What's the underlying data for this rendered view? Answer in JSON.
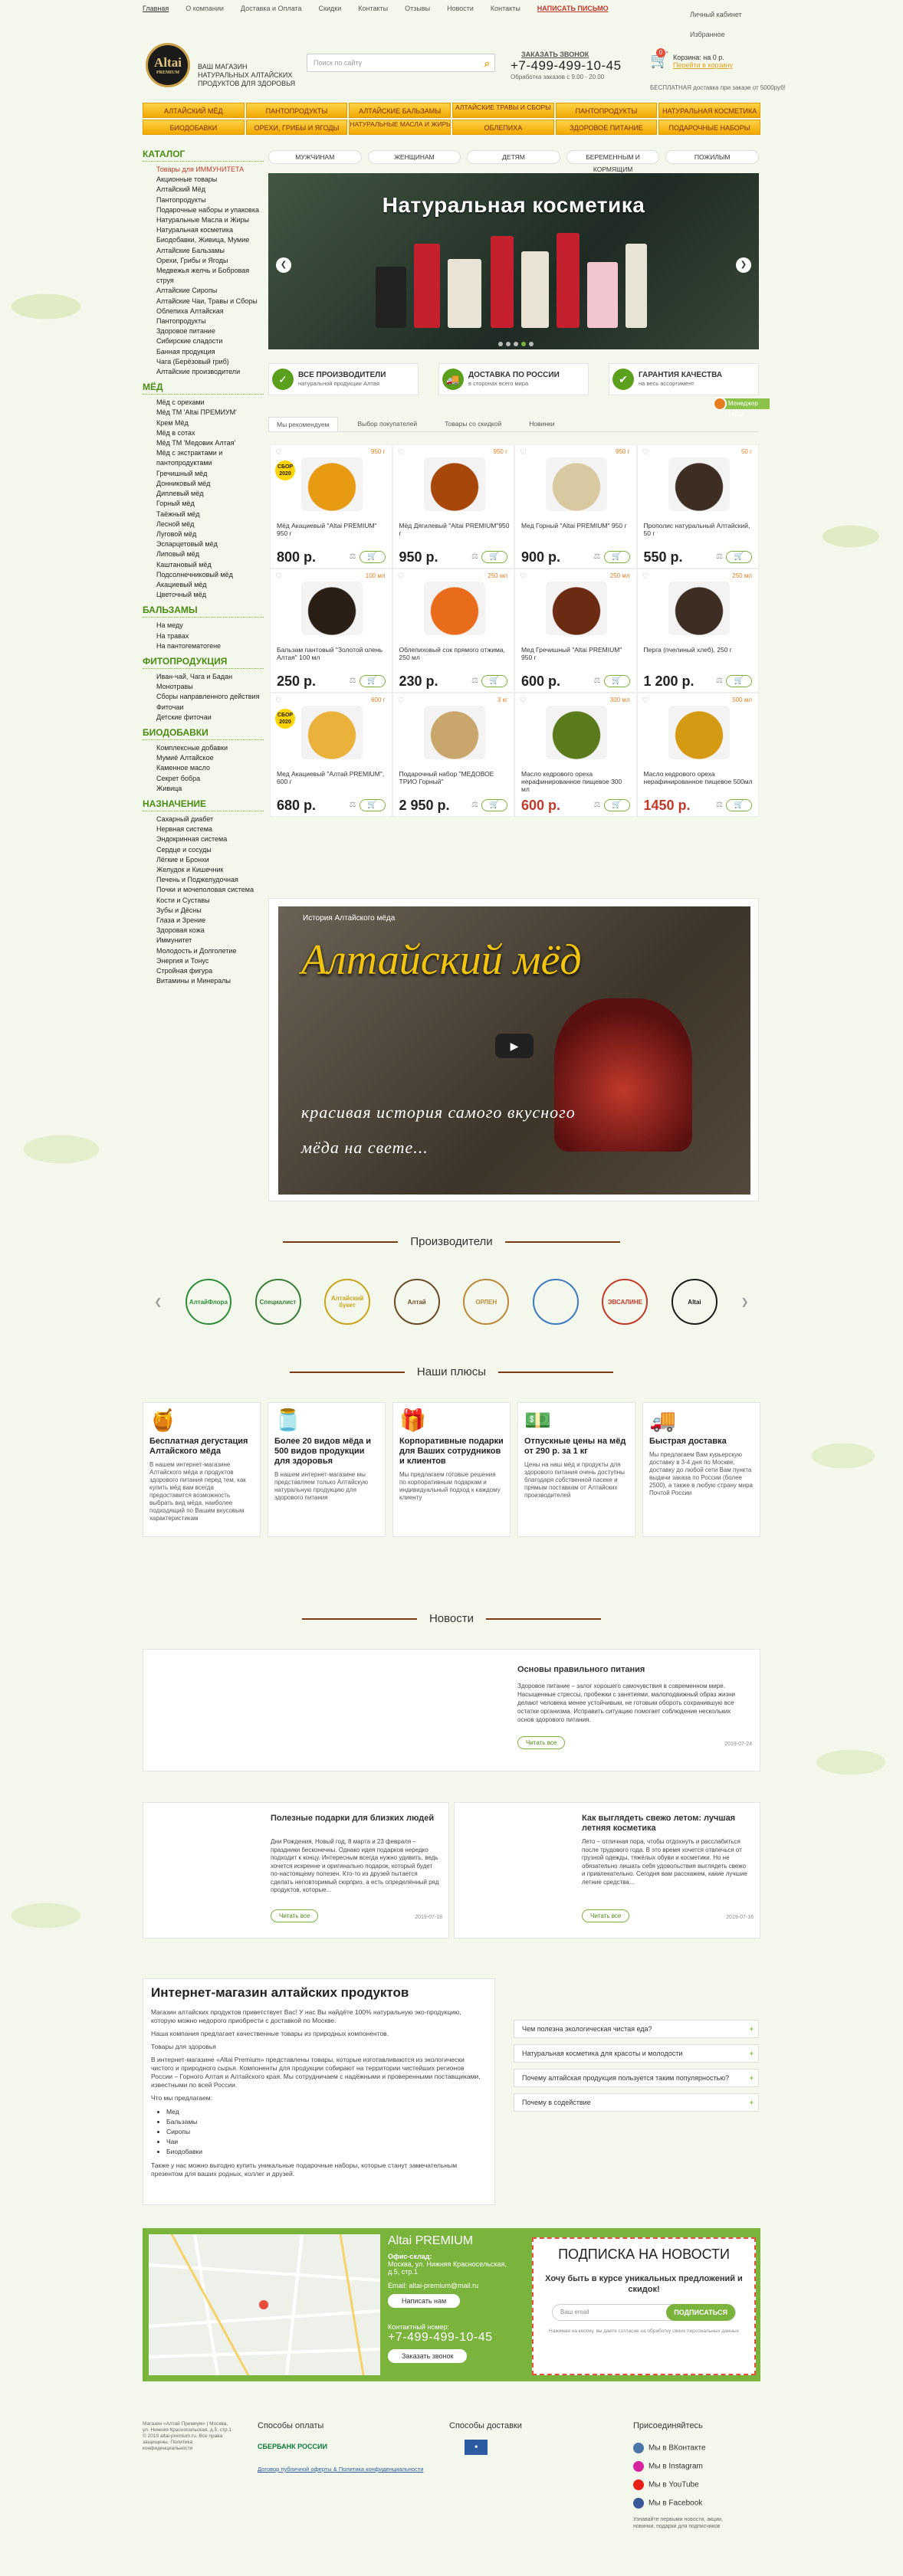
{
  "topbar": {
    "items": [
      "Главная",
      "О компании",
      "Доставка и Оплата",
      "Скидки",
      "Контакты",
      "Отзывы",
      "Новости",
      "Контакты"
    ],
    "write": "НАПИСАТЬ ПИСЬМО",
    "account": "Личный кабинет",
    "favorites": "Избранное"
  },
  "header": {
    "logo": "Altai",
    "logo_sub": "PREMIUM",
    "slogan": "ВАШ МАГАЗИН НАТУРАЛЬНЫХ АЛТАЙСКИХ ПРОДУКТОВ ДЛЯ ЗДОРОВЬЯ",
    "search_placeholder": "Поиск по сайту",
    "call_label": "ЗАКАЗАТЬ ЗВОНОК",
    "phone": "+7-499-499-10-45",
    "hours": "Обработка заказов с 9.00 - 20.00",
    "cart_count": "0",
    "cart_text": "Корзина: на 0 р.",
    "cart_link": "Перейти в корзину",
    "free_ship": "БЕСПЛАТНАЯ доставка при заказе от 5000руб!"
  },
  "nav": [
    "АЛТАЙСКИЙ МЁД",
    "ПАНТОПРОДУКТЫ",
    "АЛТАЙСКИЕ БАЛЬЗАМЫ",
    "АЛТАЙСКИЕ ТРАВЫ И СБОРЫ",
    "ПАНТОПРОДУКТЫ",
    "НАТУРАЛЬНАЯ КОСМЕТИКА",
    "БИОДОБАВКИ",
    "ОРЕХИ, ГРИБЫ И ЯГОДЫ",
    "НАТУРАЛЬНЫЕ МАСЛА И ЖИРЫ",
    "ОБЛЕПИХА",
    "ЗДОРОВОЕ ПИТАНИЕ",
    "ПОДАРОЧНЫЕ НАБОРЫ"
  ],
  "sidebar": [
    {
      "head": "КАТАЛОГ",
      "items": [
        "Товары для ИММУНИТЕТА",
        "Акционные товары",
        "Алтайский Мёд",
        "Пантопродукты",
        "Подарочные наборы и упаковка",
        "Натуральные Масла и Жиры",
        "Натуральная косметика",
        "Биодобавки, Живица, Мумие",
        "Алтайские Бальзамы",
        "Орехи, Грибы и Ягоды",
        "Медвежья желчь и Бобровая струя",
        "Алтайские Сиропы",
        "Алтайские Чаи, Травы и Сборы",
        "Облепиха Алтайская",
        "Пантопродукты",
        "Здоровое питание",
        "Сибирские сладости",
        "Банная продукция",
        "Чага (Берёзовый гриб)",
        "Алтайские производители"
      ]
    },
    {
      "head": "МЁД",
      "items": [
        "Мёд с орехами",
        "Мёд ТМ 'Altai ПРЕМИУМ'",
        "Крем Мёд",
        "Мёд в сотах",
        "Мёд ТМ 'Медовик Алтая'",
        "Мёд с экстрактами и пантопродуктами",
        "Гречишный мёд",
        "Донниковый мёд",
        "Диплевый мёд",
        "Горный мёд",
        "Таёжный мёд",
        "Лесной мёд",
        "Луговой мёд",
        "Эспарцетовый мёд",
        "Липовый мёд",
        "Каштановый мёд",
        "Подсолнечниковый мёд",
        "Акациевый мёд",
        "Цветочный мёд"
      ]
    },
    {
      "head": "БАЛЬЗАМЫ",
      "items": [
        "На меду",
        "На травах",
        "На пантогематогене"
      ]
    },
    {
      "head": "ФИТОПРОДУКЦИЯ",
      "items": [
        "Иван-чай, Чага и Бадан",
        "Монотравы",
        "Сборы направленного действия",
        "Фиточаи",
        "Детские фиточаи"
      ]
    },
    {
      "head": "БИОДОБАВКИ",
      "items": [
        "Комплексные добавки",
        "Мумиё Алтайское",
        "Каменное масло",
        "Секрет бобра",
        "Живица"
      ]
    },
    {
      "head": "НАЗНАЧЕНИЕ",
      "items": [
        "Сахарный диабет",
        "Нервная система",
        "Эндокринная система",
        "Сердце и сосуды",
        "Лёгкие и Бронхи",
        "Желудок и Кишечник",
        "Печень и Поджелудочная",
        "Почки и мочеполовая система",
        "Кости и Суставы",
        "Зубы и Дёсны",
        "Глаза и Зрение",
        "Здоровая кожа",
        "Иммунитет",
        "Молодость и Долголетие",
        "Энергия и Тонус",
        "Стройная фигура",
        "Витамины и Минералы"
      ]
    }
  ],
  "filters": [
    "МУЖЧИНАМ",
    "ЖЕНЩИНАМ",
    "ДЕТЯМ",
    "БЕРЕМЕННЫМ И КОРМЯЩИМ",
    "ПОЖИЛЫМ"
  ],
  "banner": {
    "title": "Натуральная косметика"
  },
  "features": [
    {
      "title": "ВСЕ ПРОИЗВОДИТЕЛИ",
      "sub": "натуральной продукции Алтая",
      "icon": "✓"
    },
    {
      "title": "ДОСТАВКА ПО РОССИИ",
      "sub": "в сторонах всего мира",
      "icon": "🚚"
    },
    {
      "title": "ГАРАНТИЯ КАЧЕСТВА",
      "sub": "на весь ассортимент",
      "icon": "✔"
    }
  ],
  "manager": "Менеджер сайта",
  "tabs": [
    "Мы рекомендуем",
    "Выбор покупателей",
    "Товары со скидкой",
    "Новинки"
  ],
  "products": [
    {
      "weight": "950 г",
      "name": "Мёд Акациевый \"Altai PREMIUM\" 950 г",
      "price": "800 р.",
      "color": "#e79a13",
      "badge": "СБОР 2020"
    },
    {
      "weight": "950 г",
      "name": "Мёд Дягилевый \"Altai PREMIUM\"950 г",
      "price": "950 р.",
      "color": "#a8470a",
      "badge": ""
    },
    {
      "weight": "950 г",
      "name": "Мед Горный \"Altai PREMIUM\" 950 г",
      "price": "900 р.",
      "color": "#d9c9a0",
      "badge": ""
    },
    {
      "weight": "50 г",
      "name": "Прополис натуральный Алтайский, 50 г",
      "price": "550 р.",
      "color": "#3d2d22",
      "badge": ""
    },
    {
      "weight": "100 мл",
      "name": "Бальзам пантовый \"Золотой олень Алтая\" 100 мл",
      "price": "250 р.",
      "color": "#2a1f16",
      "badge": ""
    },
    {
      "weight": "250 мл",
      "name": "Облепиховый сок прямого отжима, 250 мл",
      "price": "230 р.",
      "color": "#e96b1c",
      "badge": ""
    },
    {
      "weight": "250 мл",
      "name": "Мед Гречишный \"Altai PREMIUM\" 950 г",
      "price": "600 р.",
      "color": "#6b2a12",
      "badge": ""
    },
    {
      "weight": "250 мл",
      "name": "Перга (пчелиный хлеб), 250 г",
      "price": "1 200 р.",
      "color": "#3d2d22",
      "badge": ""
    },
    {
      "weight": "600 г",
      "name": "Мед Акациевый \"Алтай PREMIUM\", 600 г",
      "price": "680 р.",
      "color": "#eab23a",
      "badge": "СБОР 2020"
    },
    {
      "weight": "3 кг",
      "name": "Подарочный набор \"МЕДОВОЕ ТРИО Горный\"",
      "price": "2 950 р.",
      "color": "#c9a66b",
      "badge": ""
    },
    {
      "weight": "300 мл",
      "name": "Масло кедрового ореха нерафинированное пищевое 300 мл",
      "price": "600 р.",
      "color": "#5a7a1c",
      "badge": "",
      "red": true
    },
    {
      "weight": "500 мл",
      "name": "Масло кедрового ореха нерафинированное пищевое 500мл",
      "price": "1450 р.",
      "color": "#d49a14",
      "badge": "",
      "red": true
    }
  ],
  "video": {
    "title": "История Алтайского мёда",
    "big": "Алтайский мёд",
    "sub": "красивая история самого вкусного мёда на свете..."
  },
  "producers_title": "Производители",
  "producers": [
    {
      "name": "АлтайФлора",
      "color": "#2e8b3a"
    },
    {
      "name": "Специалист",
      "color": "#3a7a3a"
    },
    {
      "name": "Алтайский букет",
      "color": "#c7a51d"
    },
    {
      "name": "Алтай",
      "color": "#6b4a2a"
    },
    {
      "name": "ОРЛЕН",
      "color": "#b88a3a"
    },
    {
      "name": "",
      "color": "#3c7abf"
    },
    {
      "name": "ЭВСАЛИНЕ",
      "color": "#c0392b"
    },
    {
      "name": "Altai",
      "color": "#1b1b1b"
    }
  ],
  "advantages_title": "Наши плюсы",
  "advantages": [
    {
      "title": "Бесплатная дегустация Алтайского мёда",
      "text": "В нашем интернет-магазине Алтайского мёда и продуктов здорового питания перед тем, как купить мёд вам всегда предоставится возможность выбрать вид мёда, наиболее подходящий по Вашим вкусовым характеристикам",
      "icon": "🍯"
    },
    {
      "title": "Более 20 видов мёда и 500 видов продукции для здоровья",
      "text": "В нашем интернет-магазине мы представляем только Алтайскую натуральную продукцию для здорового питания",
      "icon": "🫙"
    },
    {
      "title": "Корпоративные подарки для Ваших сотрудников и клиентов",
      "text": "Мы предлагаем готовые решения по корпоративным подаркам и индивидуальный подход к каждому клиенту",
      "icon": "🎁"
    },
    {
      "title": "Отпускные цены на мёд от 290 р. за 1 кг",
      "text": "Цены на наш мёд и продукты для здорового питания очень доступны благодаря собственной пасеке и прямым поставкам от Алтайских производителей",
      "icon": "💵"
    },
    {
      "title": "Быстрая доставка",
      "text": "Мы предлагаем Вам курьерскую доставку в 3-4 дня по Москве, доставку до любой сети Вам пункта выдачи заказа по России (более 2500), а также в любую страну мира Почтой России",
      "icon": "🚚"
    }
  ],
  "news_title": "Новости",
  "news": [
    {
      "title": "Основы правильного питания",
      "text": "Здоровое питание – залог хорошего самочувствия в современном мире. Насыщенные стрессы, пробежки с занятиями, малоподвижный образ жизни делают человека менее устойчивым, не готовым обороть сохранившую все остатки организма. Исправить ситуацию помогает соблюдение нескольких основ здорового питания.",
      "button": "Читать все",
      "date": "2019-07-24"
    },
    {
      "title": "Полезные подарки для близких людей",
      "text": "Дни Рождения, Новый год, 8 марта и 23 февраля – праздники бесконечны. Однако идея подарков нередко подходит к концу. Интересным всегда нужно удивить, ведь хочется искренне и оригинально подарок, который будет по-настоящему полезен. Кто-то из друзей пытается сделать неповторимый сюрприз, а есть определённый ряд продуктов, которые...",
      "button": "Читать все",
      "date": "2019-07-18"
    },
    {
      "title": "Как выглядеть свежо летом: лучшая летняя косметика",
      "text": "Лето – отличная пора, чтобы отдохнуть и расслабиться после трудового года. В это время хочется отвлечься от грузной одежды, тяжёлых обуви и косметики. Но не обязательно лишать себя удовольствия выглядеть свежо и привлекательно. Сегодня вам расскажем, какие лучшие летние средства...",
      "button": "Читать все",
      "date": "2019-07-16"
    }
  ],
  "about": {
    "title": "Интернет-магазин алтайских продуктов",
    "p1": "Магазин алтайских продуктов приветствует Вас! У нас Вы найдёте 100% натуральную эко-продукцию, которую можно недорого приобрести с доставкой по Москве.",
    "p2": "Наша компания предлагает качественные товары из природных компонентов.",
    "p3": "Товары для здоровья",
    "p4": "В интернет-магазине «Altai Premium» представлены товары, которые изготавливаются из экологически чистого и природного сырья. Компоненты для продукции собирают на территории чистейших регионов России – Горного Алтая и Алтайского края. Мы сотрудничаем с надёжными и проверенными поставщиками, известными по всей России.",
    "p5": "Что мы предлагаем:",
    "list": [
      "Мед",
      "Бальзамы",
      "Сиропы",
      "Чаи",
      "Биодобавки"
    ],
    "p6": "Также у нас можно выгодно купить уникальные подарочные наборы, которые станут замечательным презентом для ваших родных, коллег и друзей."
  },
  "faq": [
    "Чем полезна экологическая чистая еда?",
    "Натуральная косметика для красоты и молодости",
    "Почему алтайская продукция пользуется таким популярностью?",
    "Почему в содействие"
  ],
  "contact": {
    "brand": "Altai PREMIUM",
    "office_label": "Офис-склад:",
    "address": "Москва, ул. Нижняя Красносельская, д.5, стр.1",
    "email": "Email: altai-premium@mail.ru",
    "write": "Написать нам",
    "tel_label": "Контактный номер:",
    "phone": "+7-499-499-10-45",
    "call": "Заказать звонок"
  },
  "subscribe": {
    "title": "ПОДПИСКА НА НОВОСТИ",
    "text": "Хочу быть в курсе уникальных предложений и скидок!",
    "placeholder": "Ваш email",
    "button": "ПОДПИСАТЬСЯ",
    "note": "Нажимая на кнопку, вы даете согласие на обработку своих персональных данных"
  },
  "footer": {
    "copy": "Магазин «Алтай Премиум» | Москва, ул. Нижняя Красносельская, д.5, стр.1 © 2019 altai-premium.ru. Все права защищены. Политика конфиденциальности",
    "pay_title": "Способы оплаты",
    "pay": "СБЕРБАНК РОССИИ",
    "oferta": "Договор публичной оферты & Политика конфиденциальности",
    "delivery_title": "Способы доставки",
    "join_title": "Присоединяйтесь",
    "socials": [
      "Мы в ВКонтакте",
      "Мы в Instagram",
      "Мы в YouTube",
      "Мы в Facebook"
    ],
    "social_note": "Узнавайте первыми новости, акции, новинки, подарки для подписчиков"
  }
}
